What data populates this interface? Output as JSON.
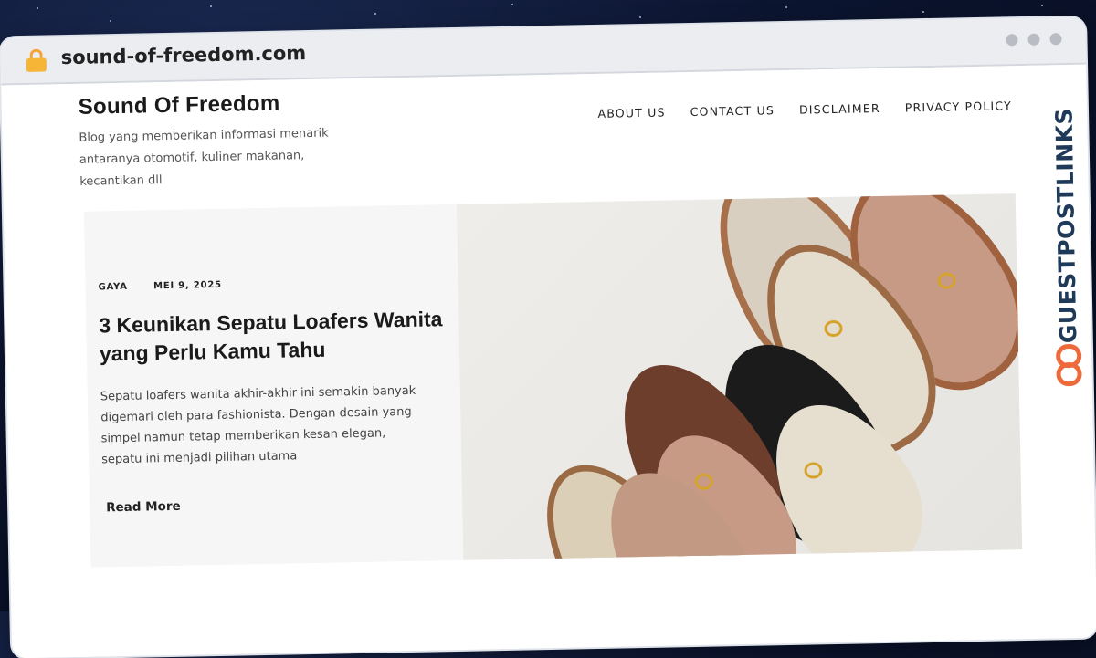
{
  "browser": {
    "url": "sound-of-freedom.com"
  },
  "site": {
    "title": "Sound Of Freedom",
    "tagline": "Blog yang memberikan informasi menarik antaranya otomotif, kuliner makanan, kecantikan dll"
  },
  "nav": {
    "items": [
      {
        "label": "ABOUT US"
      },
      {
        "label": "CONTACT US"
      },
      {
        "label": "DISCLAIMER"
      },
      {
        "label": "PRIVACY POLICY"
      }
    ]
  },
  "featured_post": {
    "category": "GAYA",
    "date": "MEI 9, 2025",
    "title": "3 Keunikan Sepatu Loafers Wanita yang Perlu Kamu Tahu",
    "excerpt": "Sepatu loafers wanita akhir-akhir ini semakin banyak digemari oleh para fashionista. Dengan desain yang simpel namun tetap memberikan kesan elegan, sepatu ini menjadi pilihan utama",
    "read_more": "Read More",
    "image": "loafers-photo"
  },
  "watermark": {
    "text": "GUESTPOSTLINKS",
    "icon": "chain-link-icon"
  },
  "colors": {
    "accent_orange": "#ee6a3a",
    "watermark_navy": "#1f3a58",
    "lock": "#f7b538"
  }
}
